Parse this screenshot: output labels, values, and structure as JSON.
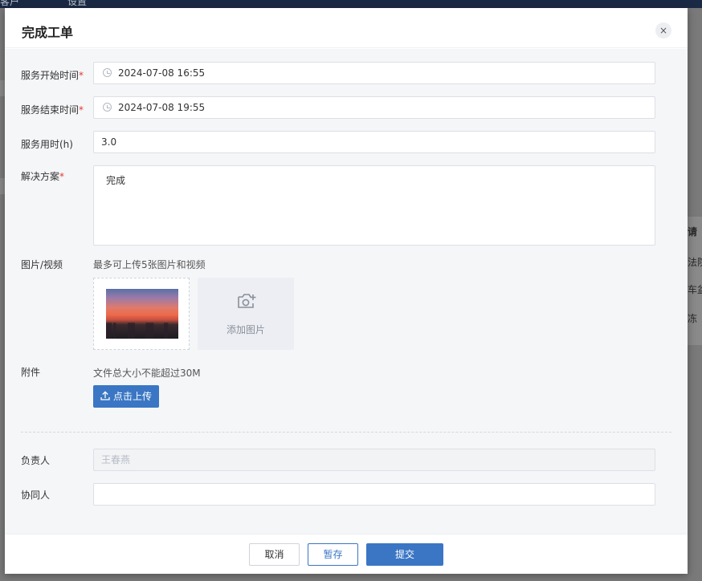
{
  "background": {
    "nav_items": [
      "客户",
      "设置"
    ],
    "right_fragments": [
      "请",
      "法院",
      "车盆",
      "冻"
    ]
  },
  "modal": {
    "title": "完成工单",
    "close_symbol": "×"
  },
  "form": {
    "start_time": {
      "label": "服务开始时间",
      "required_mark": "*",
      "value": "2024-07-08 16:55"
    },
    "end_time": {
      "label": "服务结束时间",
      "required_mark": "*",
      "value": "2024-07-08 19:55"
    },
    "hours": {
      "label": "服务用时(h)",
      "value": "3.0"
    },
    "solution": {
      "label": "解决方案",
      "required_mark": "*",
      "value": "完成"
    },
    "media": {
      "label": "图片/视频",
      "hint": "最多可上传5张图片和视频",
      "add_label": "添加图片"
    },
    "attachment": {
      "label": "附件",
      "hint": "文件总大小不能超过30M",
      "upload_label": "点击上传"
    },
    "owner": {
      "label": "负责人",
      "value": "王春燕"
    },
    "collaborator": {
      "label": "协同人",
      "value": ""
    }
  },
  "footer": {
    "cancel_label": "取消",
    "draft_label": "暂存",
    "submit_label": "提交"
  },
  "colors": {
    "primary": "#3a76c4",
    "required": "#e53935"
  }
}
